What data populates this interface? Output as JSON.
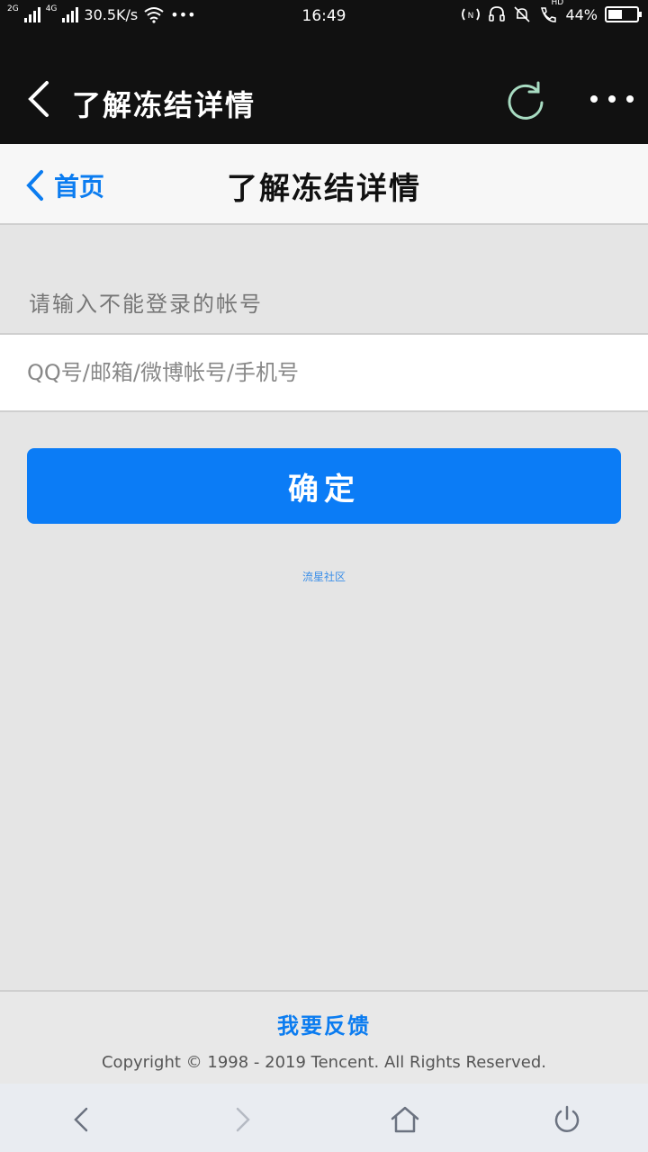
{
  "status_bar": {
    "network_2g": "2G",
    "network_4g": "4G",
    "speed": "30.5K/s",
    "dots": "•••",
    "time": "16:49",
    "hd": "HD",
    "battery_text": "44%",
    "battery_level": 0.44,
    "icons": [
      "signal-icon",
      "wifi-icon",
      "nfc-icon",
      "headset-icon",
      "mute-bell-icon",
      "hd-call-icon",
      "battery-icon"
    ]
  },
  "titlebar": {
    "title": "了解冻结详情",
    "icons": [
      "back-chevron-icon",
      "refresh-icon",
      "more-icon"
    ]
  },
  "page_header": {
    "home_label": "首页",
    "title": "了解冻结详情"
  },
  "form": {
    "label": "请输入不能登录的帐号",
    "input_placeholder": "QQ号/邮箱/微博帐号/手机号",
    "input_value": "",
    "confirm_label": "确定",
    "community_link": "流星社区"
  },
  "footer": {
    "feedback": "我要反馈",
    "copyright": "Copyright © 1998 - 2019 Tencent. All Rights Reserved."
  },
  "bottom_nav": {
    "icons": [
      "back-icon",
      "forward-icon",
      "home-icon",
      "power-icon"
    ]
  },
  "colors": {
    "accent": "#0b7cf6",
    "link": "#0b7cf0",
    "status_bg": "#111111",
    "page_bg": "#e5e5e5"
  }
}
